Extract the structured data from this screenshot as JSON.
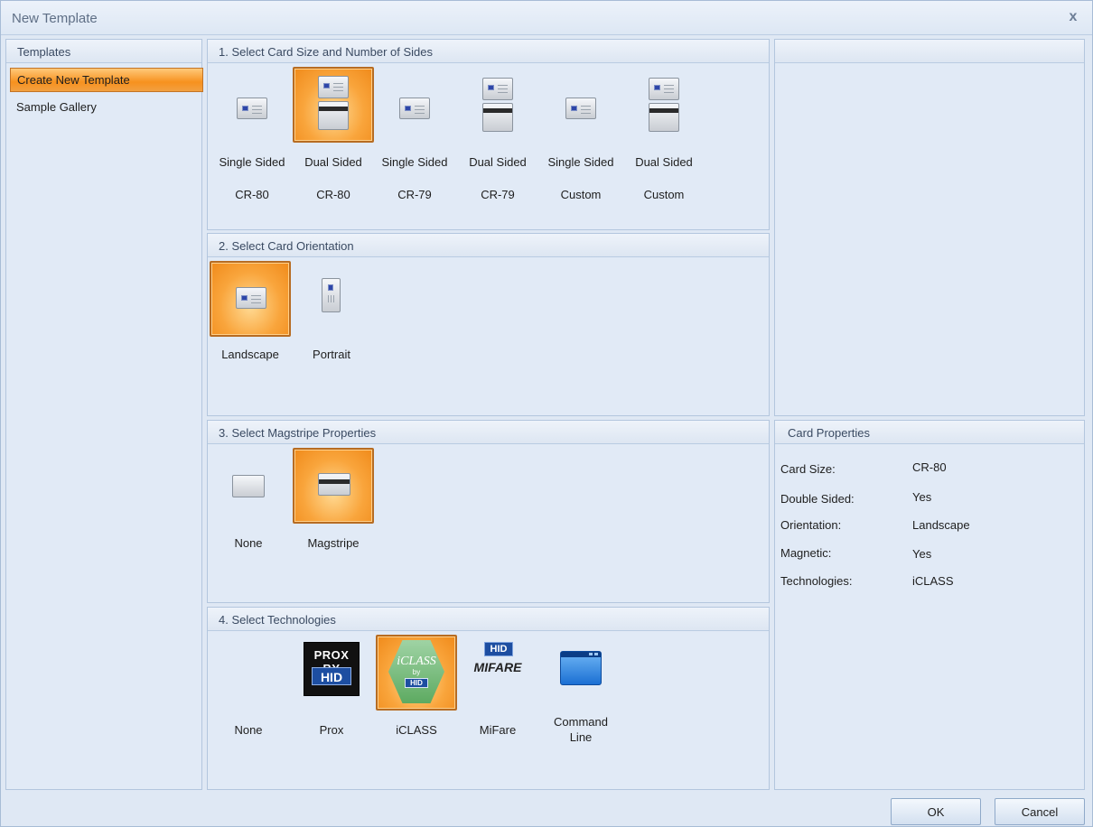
{
  "window": {
    "title": "New Template",
    "close_glyph": "x"
  },
  "templates": {
    "header": "Templates",
    "items": [
      {
        "label": "Create New Template",
        "selected": true
      },
      {
        "label": "Sample Gallery",
        "selected": false
      }
    ]
  },
  "card_size": {
    "header": "1. Select Card Size and Number of Sides",
    "options": [
      {
        "line1": "Single Sided",
        "line2": "CR-80",
        "icon": "single-card-icon",
        "selected": false
      },
      {
        "line1": "Dual Sided",
        "line2": "CR-80",
        "icon": "dual-card-icon",
        "selected": true
      },
      {
        "line1": "Single Sided",
        "line2": "CR-79",
        "icon": "single-card-icon",
        "selected": false
      },
      {
        "line1": "Dual Sided",
        "line2": "CR-79",
        "icon": "dual-card-icon",
        "selected": false
      },
      {
        "line1": "Single Sided",
        "line2": "Custom",
        "icon": "single-card-icon",
        "selected": false
      },
      {
        "line1": "Dual Sided",
        "line2": "Custom",
        "icon": "dual-card-icon",
        "selected": false
      }
    ]
  },
  "orientation": {
    "header": "2. Select Card Orientation",
    "options": [
      {
        "label": "Landscape",
        "icon": "landscape-card-icon",
        "selected": true
      },
      {
        "label": "Portrait",
        "icon": "portrait-card-icon",
        "selected": false
      }
    ]
  },
  "magstripe": {
    "header": "3. Select Magstripe Properties",
    "options": [
      {
        "label": "None",
        "icon": "blank-card-icon",
        "selected": false
      },
      {
        "label": "Magstripe",
        "icon": "magstripe-card-icon",
        "selected": true
      }
    ]
  },
  "technologies": {
    "header": "4. Select Technologies",
    "options": [
      {
        "label": "None",
        "icon": "none-icon",
        "selected": false
      },
      {
        "label": "Prox",
        "icon": "prox-logo-icon",
        "selected": false
      },
      {
        "label": "iCLASS",
        "icon": "iclass-logo-icon",
        "selected": true
      },
      {
        "label": "MiFare",
        "icon": "mifare-logo-icon",
        "selected": false
      },
      {
        "label": "Command\nLine",
        "icon": "command-line-window-icon",
        "selected": false
      }
    ],
    "logo_text": {
      "prox_top": "PROX BY",
      "prox_bottom": "HID",
      "iclass_top": "iCLASS",
      "iclass_by": "by",
      "iclass_bottom": "HID",
      "mifare_top": "HID",
      "mifare_bottom": "MIFARE"
    }
  },
  "card_properties": {
    "header": "Card Properties",
    "rows": [
      {
        "label": "Card Size:",
        "value": "CR-80"
      },
      {
        "label": "Double Sided:",
        "value": "Yes"
      },
      {
        "label": "Orientation:",
        "value": "Landscape"
      },
      {
        "label": "Magnetic:",
        "value": "Yes"
      },
      {
        "label": "Technologies:",
        "value": "iCLASS"
      }
    ]
  },
  "buttons": {
    "ok": "OK",
    "cancel": "Cancel"
  },
  "colors": {
    "selection_orange": "#f7911e",
    "panel_bg": "#e1eaf6",
    "border_blue": "#b3c6de",
    "hid_blue": "#1d4ea1"
  }
}
